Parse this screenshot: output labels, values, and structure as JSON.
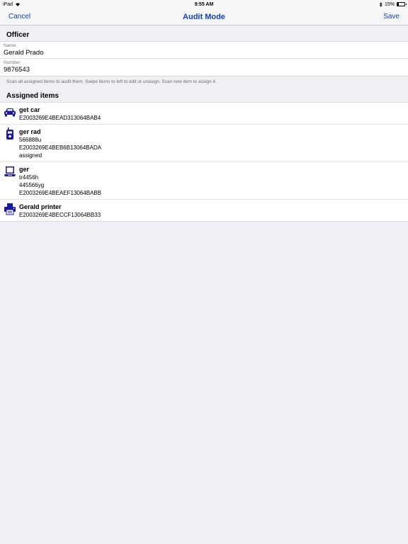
{
  "status": {
    "device": "iPad",
    "time": "9:55 AM",
    "battery": "15%",
    "battery_level": 0.15
  },
  "nav": {
    "cancel_label": "Cancel",
    "title": "Audit Mode",
    "save_label": "Save"
  },
  "officer": {
    "section_title": "Officer",
    "name_label": "Name:",
    "name_value": "Gerald Prado",
    "number_label": "Number:",
    "number_value": "9876543"
  },
  "hint": "Scan all assigned items to audit them. Swipe items to left to edit or unasign. Scan new item to assign it.",
  "assigned": {
    "section_title": "Assigned items",
    "items": [
      {
        "icon": "car-icon",
        "name": "get car",
        "lines": [
          "E2003269E4BEAD313064BAB4"
        ]
      },
      {
        "icon": "radio-icon",
        "name": "ger rad",
        "lines": [
          "566888u",
          "E2003269E4BEB6B13064BADA",
          "assigned"
        ]
      },
      {
        "icon": "laptop-icon",
        "name": "ger",
        "lines": [
          "tr4456h",
          "445566yg",
          "E2003269E4BEAEF13064BABB"
        ]
      },
      {
        "icon": "printer-icon",
        "name": "Gerald printer",
        "lines": [
          "E2003269E4BECCF13064BB33"
        ]
      }
    ]
  },
  "colors": {
    "accent": "#0c3fc4",
    "icon": "#1a1a9e",
    "background": "#efeff4"
  }
}
